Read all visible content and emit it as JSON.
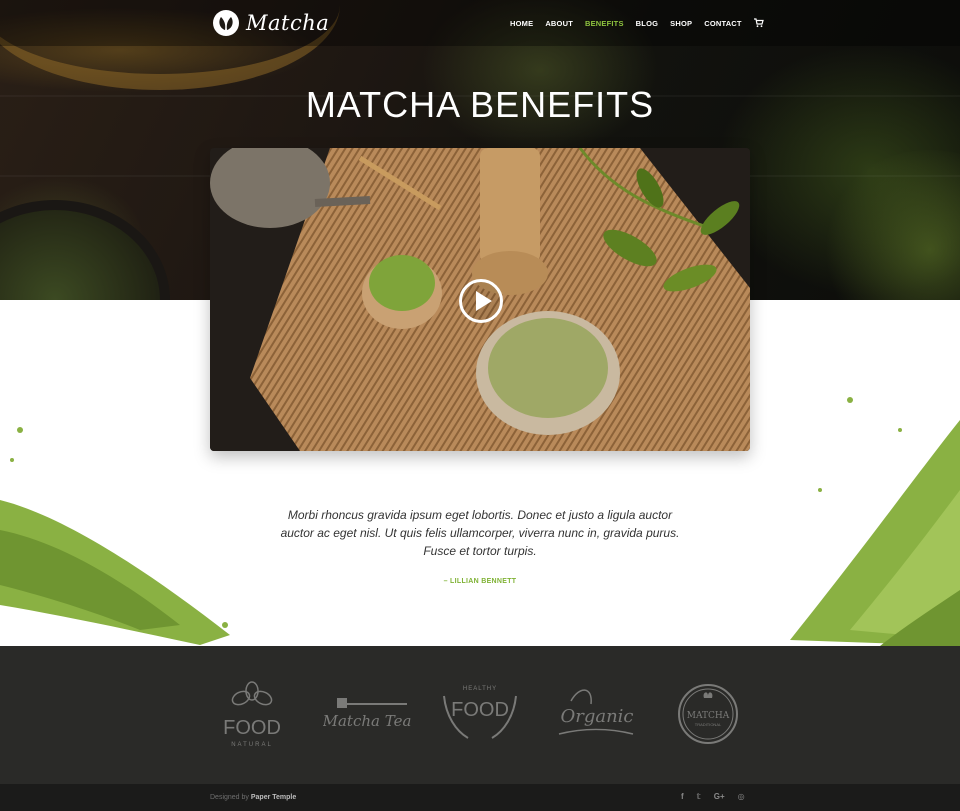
{
  "brand": {
    "name": "Matcha",
    "logo_icon": "leaf-circle-icon"
  },
  "nav": {
    "items": [
      {
        "label": "HOME"
      },
      {
        "label": "ABOUT"
      },
      {
        "label": "BENEFITS",
        "active": true
      },
      {
        "label": "BLOG"
      },
      {
        "label": "SHOP"
      },
      {
        "label": "CONTACT"
      }
    ],
    "cart_icon": "cart-icon"
  },
  "hero": {
    "title": "MATCHA BENEFITS"
  },
  "video": {
    "play_icon": "play-icon"
  },
  "testimonial": {
    "quote": "Morbi rhoncus gravida ipsum eget lobortis. Donec et justo a ligula auctor auctor ac eget nisl. Ut quis felis ullamcorper, viverra nunc in, gravida purus. Fusce et tortor turpis.",
    "author": "– LILLIAN BENNETT"
  },
  "partner_logos": [
    {
      "name": "FOOD",
      "sub": "NATURAL"
    },
    {
      "name": "Matcha Tea"
    },
    {
      "top": "HEALTHY",
      "name": "FOOD"
    },
    {
      "name": "Organic"
    },
    {
      "name": "MATCHA",
      "sub": "TRADITIONAL"
    }
  ],
  "footer": {
    "credit_prefix": "Designed by",
    "credit_name": "Paper Temple",
    "socials": [
      "f",
      "𝕥",
      "G+",
      "◎"
    ]
  },
  "colors": {
    "accent": "#8fc43f",
    "author": "#7fb234",
    "logos_bg": "#2a2a28",
    "footer_bg": "#1b1b1a"
  }
}
